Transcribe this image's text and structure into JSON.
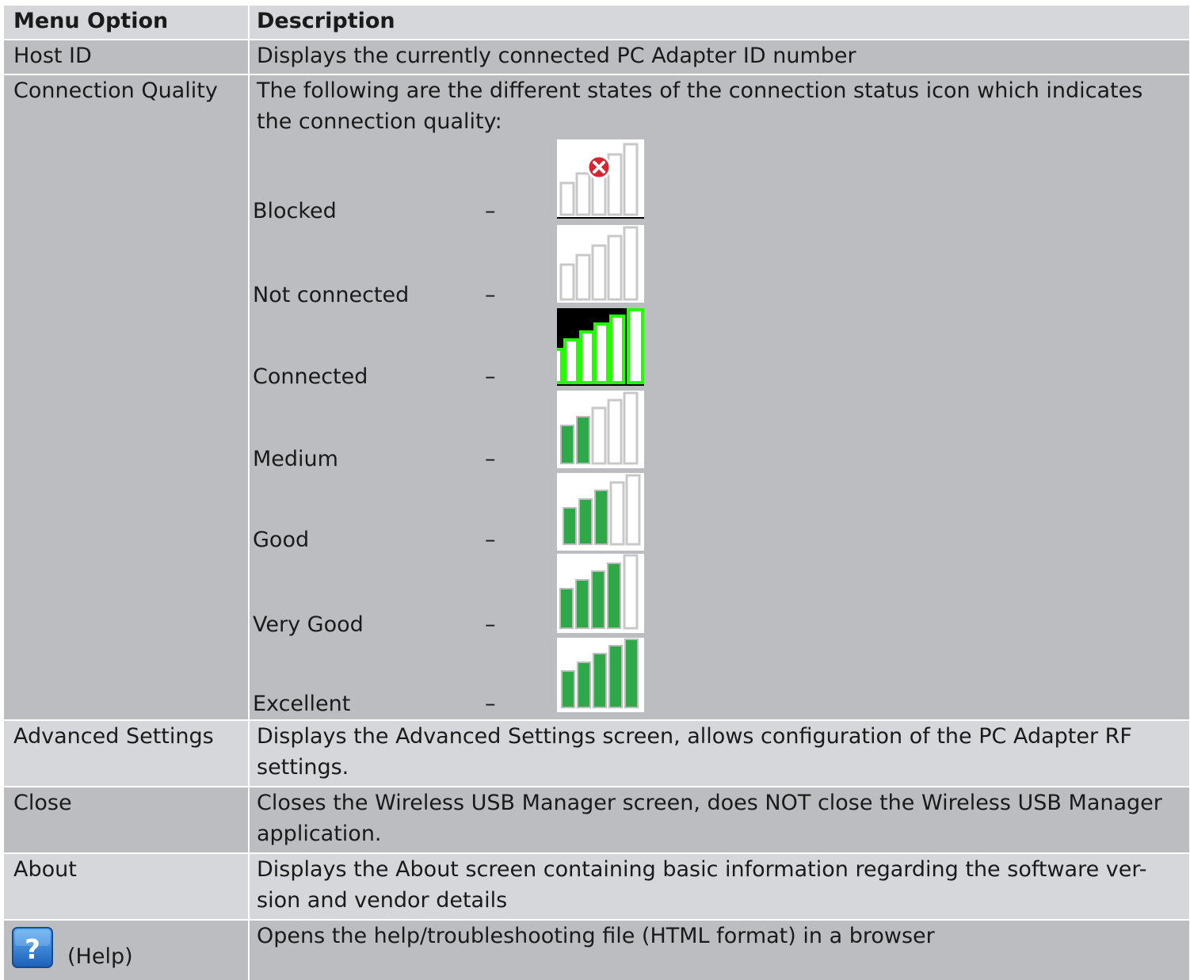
{
  "header": {
    "col1": "Menu Option",
    "col2": "Description"
  },
  "rows": {
    "host_id": {
      "option": "Host ID",
      "description": "Displays the currently connected PC Adapter ID number"
    },
    "connection_quality": {
      "option": "Connection Quality",
      "description": "The following are the different states of the connection status icon which indicates the connection quality:",
      "states": [
        {
          "label": "Blocked",
          "dash": "–",
          "icon": "signal-blocked-icon",
          "bars_filled": 0
        },
        {
          "label": "Not connected",
          "dash": "–",
          "icon": "signal-not-connected-icon",
          "bars_filled": 0
        },
        {
          "label": "Connected",
          "dash": "–",
          "icon": "signal-connected-icon",
          "bars_filled": 0
        },
        {
          "label": "Medium",
          "dash": "–",
          "icon": "signal-medium-icon",
          "bars_filled": 2
        },
        {
          "label": "Good",
          "dash": "–",
          "icon": "signal-good-icon",
          "bars_filled": 3
        },
        {
          "label": "Very Good",
          "dash": "–",
          "icon": "signal-very-good-icon",
          "bars_filled": 4
        },
        {
          "label": "Excellent",
          "dash": "–",
          "icon": "signal-excellent-icon",
          "bars_filled": 5
        }
      ]
    },
    "advanced_settings": {
      "option": "Advanced Settings",
      "description": "Displays the Advanced Settings screen, allows configuration of the PC Adapter RF settings."
    },
    "close": {
      "option": "Close",
      "description": "Closes the Wireless USB Manager screen, does NOT close the Wireless USB Manager application."
    },
    "about": {
      "option": "About",
      "description": "Displays the About screen containing basic information regarding the software ver-sion and vendor details"
    },
    "help": {
      "option": "(Help)",
      "icon": "help-question-icon",
      "description": "Opens the help/troubleshooting file (HTML format) in a browser"
    }
  },
  "colors": {
    "row_light": "#d6d7da",
    "row_dark": "#bcbdc1",
    "bar_green": "#2fa84a",
    "blocked_red": "#d9242f",
    "connected_green": "#22ff00",
    "help_blue": "#2a7fd6"
  }
}
